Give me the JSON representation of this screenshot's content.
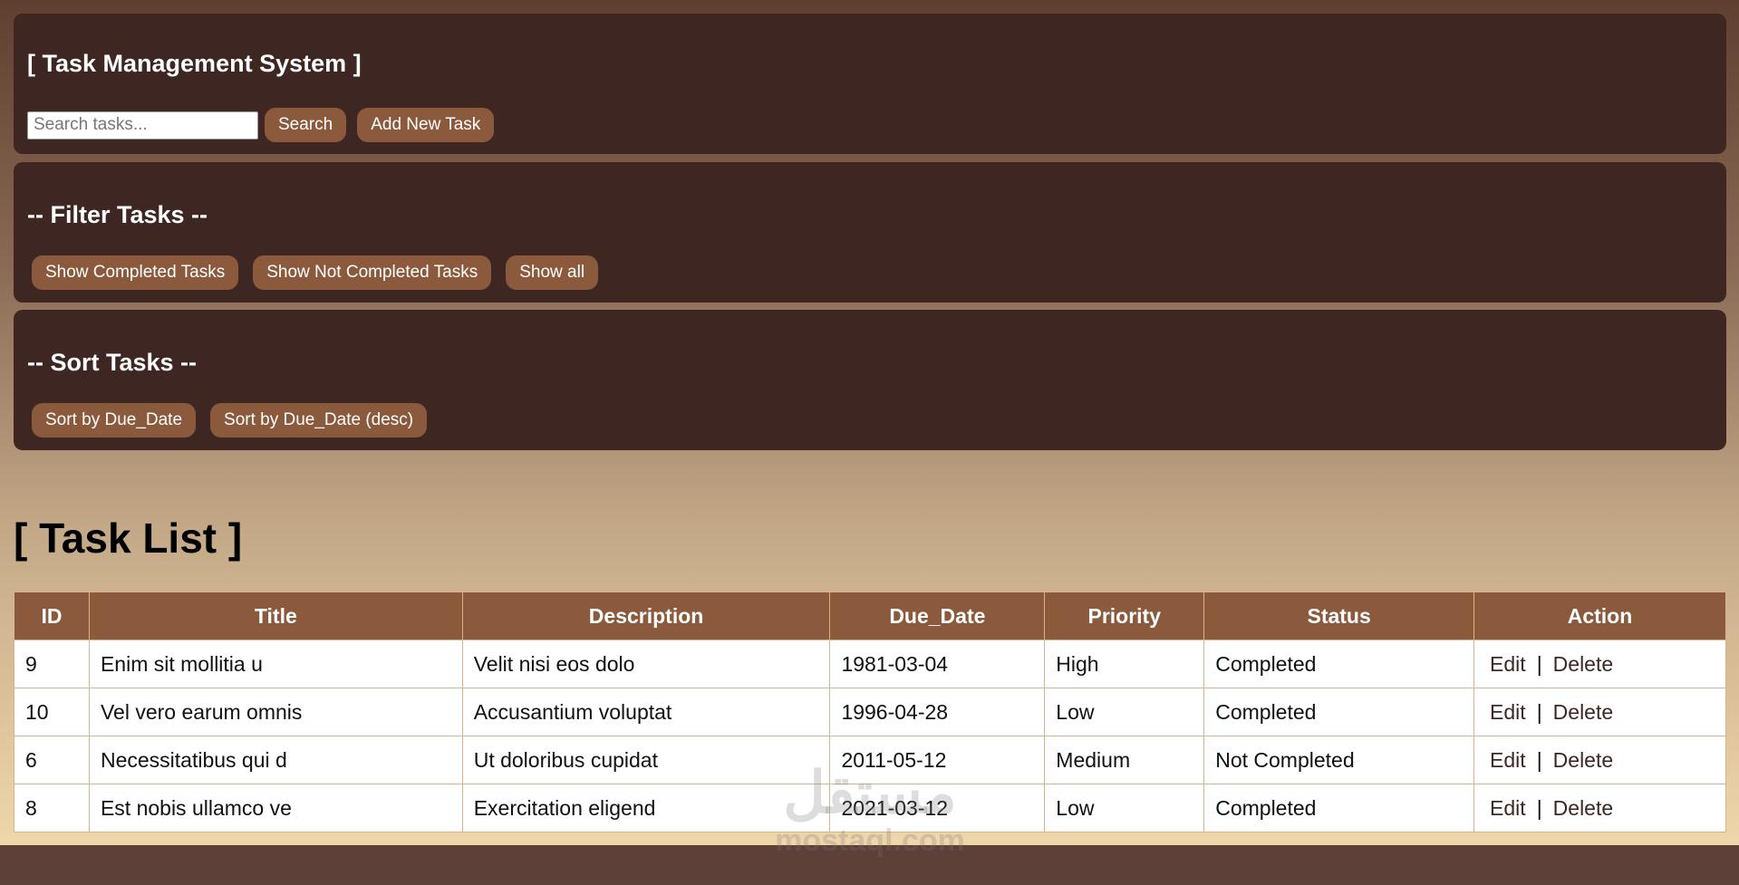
{
  "header": {
    "title": "[ Task Management System ]",
    "search_placeholder": "Search tasks...",
    "search_button": "Search",
    "add_button": "Add New Task"
  },
  "filter": {
    "title": "-- Filter Tasks --",
    "buttons": [
      "Show Completed Tasks",
      "Show Not Completed Tasks",
      "Show all"
    ]
  },
  "sort": {
    "title": "-- Sort Tasks --",
    "buttons": [
      "Sort by Due_Date",
      "Sort by Due_Date (desc)"
    ]
  },
  "task_list": {
    "title": "[ Task List ]",
    "columns": [
      "ID",
      "Title",
      "Description",
      "Due_Date",
      "Priority",
      "Status",
      "Action"
    ],
    "rows": [
      {
        "id": "9",
        "title": "Enim sit mollitia u",
        "description": "Velit nisi eos dolo",
        "due_date": "1981-03-04",
        "priority": "High",
        "status": "Completed"
      },
      {
        "id": "10",
        "title": "Vel vero earum omnis",
        "description": "Accusantium voluptat",
        "due_date": "1996-04-28",
        "priority": "Low",
        "status": "Completed"
      },
      {
        "id": "6",
        "title": "Necessitatibus qui d",
        "description": "Ut doloribus cupidat",
        "due_date": "2011-05-12",
        "priority": "Medium",
        "status": "Not Completed"
      },
      {
        "id": "8",
        "title": "Est nobis ullamco ve",
        "description": "Exercitation eligend",
        "due_date": "2021-03-12",
        "priority": "Low",
        "status": "Completed"
      }
    ],
    "action_edit": "Edit",
    "action_separator": "|",
    "action_delete": "Delete"
  },
  "watermark": {
    "top": "مستقل",
    "bottom": "mostaql.com"
  },
  "colors": {
    "panel": "#3e2723",
    "button": "#8b5a3c",
    "footer": "#5d4037"
  }
}
